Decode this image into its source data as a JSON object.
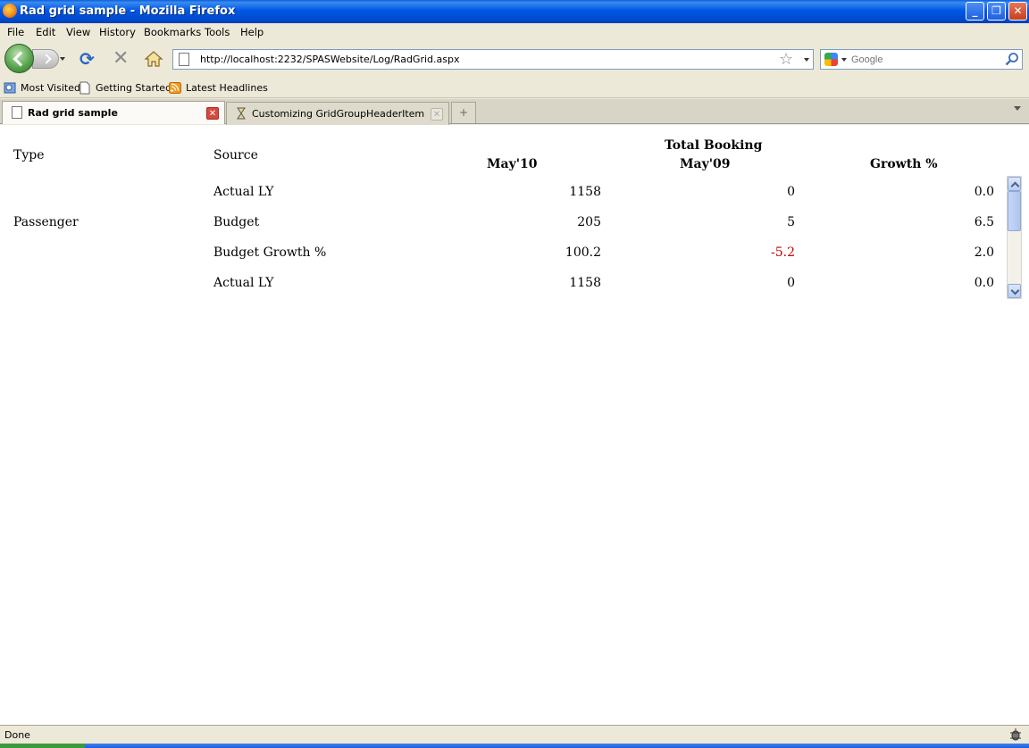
{
  "window": {
    "title": "Rad grid sample - Mozilla Firefox"
  },
  "menu": [
    "File",
    "Edit",
    "View",
    "History",
    "Bookmarks",
    "Tools",
    "Help"
  ],
  "nav": {
    "url": "http://localhost:2232/SPASWebsite/Log/RadGrid.aspx",
    "search_placeholder": "Google"
  },
  "bookmarks": [
    "Most Visited",
    "Getting Started",
    "Latest Headlines"
  ],
  "tabs": [
    {
      "label": "Rad grid sample",
      "active": true
    },
    {
      "label": "Customizing GridGroupHeaderItem",
      "active": false
    }
  ],
  "grid": {
    "headers": {
      "type": "Type",
      "source": "Source",
      "group": "Total Booking",
      "col1": "May'10",
      "col2": "May'09",
      "col3": "Growth %"
    },
    "group_label": "Passenger",
    "rows": [
      {
        "source": "Actual LY",
        "v1": "1158",
        "v2": "0",
        "v3": "0.0",
        "v2_negative": false
      },
      {
        "source": "Budget",
        "v1": "205",
        "v2": "5",
        "v3": "6.5",
        "v2_negative": false
      },
      {
        "source": "Budget Growth %",
        "v1": "100.2",
        "v2": "-5.2",
        "v3": "2.0",
        "v2_negative": true
      },
      {
        "source": "Actual LY",
        "v1": "1158",
        "v2": "0",
        "v3": "0.0",
        "v2_negative": false
      }
    ]
  },
  "status": {
    "text": "Done"
  },
  "colors": {
    "negative": "#c00000",
    "titlebar": "#0058e6"
  }
}
